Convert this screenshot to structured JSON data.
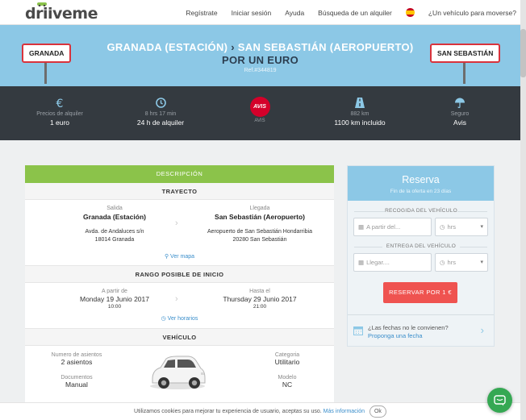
{
  "nav": {
    "logo": "driiveme",
    "links": [
      "Regístrate",
      "Iniciar sesión",
      "Ayuda",
      "Búsqueda de un alquiler"
    ],
    "flag_icon": "spain-flag-icon",
    "vehicle_question": "¿Un vehículo para moverse?"
  },
  "hero": {
    "origin_sign": "GRANADA",
    "destination_sign": "SAN SEBASTIÁN",
    "route_origin": "GRANADA (ESTACIÓN)",
    "route_arrow": "›",
    "route_destination": "SAN SEBASTIÁN (AEROPUERTO)",
    "price_line": "POR UN EURO",
    "ref": "Ref.#344819",
    "bg_color": "#8cc8e6",
    "sign_border_color": "#d9333c"
  },
  "stats": {
    "price": {
      "icon": "euro-icon",
      "label": "Precios de alquiler",
      "value": "1 euro"
    },
    "time": {
      "icon": "clock-icon",
      "label": "8 hrs 17 min",
      "value": "24 h de alquiler"
    },
    "brand": {
      "icon": "avis-logo",
      "logo_text": "AVIS",
      "label": "AVIS"
    },
    "distance": {
      "icon": "road-icon",
      "label": "882 km",
      "value": "1100 km incluido"
    },
    "insurance": {
      "icon": "umbrella-icon",
      "label": "Seguro",
      "value": "Avis"
    }
  },
  "details": {
    "tab": "DESCRIPCIÓN",
    "trayecto": {
      "header": "TRAYECTO",
      "departure_label": "Salida",
      "departure_name": "Granada (Estación)",
      "departure_addr1": "Avda. de Andaluces s/n",
      "departure_addr2": "18014 Granada",
      "arrival_label": "Llegada",
      "arrival_name": "San Sebastián (Aeropuerto)",
      "arrival_addr1": "Aeropuerto de San Sebastián Hondarribia",
      "arrival_addr2": "20280 San Sebastián",
      "map_link": "Ver mapa"
    },
    "rango": {
      "header": "RANGO POSIBLE DE INICIO",
      "from_label": "A partir de",
      "from_date": "Monday 19 Junio 2017",
      "from_time": "10:00",
      "until_label": "Hasta el",
      "until_date": "Thursday 29 Junio 2017",
      "until_time": "21:00",
      "hours_link": "Ver horarios"
    },
    "vehiculo": {
      "header": "VEHÍCULO",
      "seats_label": "Numero de asientos",
      "seats_value": "2 asientos",
      "docs_label": "Documentos",
      "docs_value": "Manual",
      "category_label": "Categoria",
      "category_value": "Utilitario",
      "model_label": "Modelo",
      "model_value": "NC"
    },
    "tab_color": "#8bc34a"
  },
  "reserva": {
    "title": "Reserva",
    "subtitle": "Fin de la oferta en 23 días",
    "pickup_label": "RECOGIDA DEL VEHÍCULO",
    "pickup_date_placeholder": "A partir del...",
    "pickup_hour_placeholder": "hrs",
    "dropoff_label": "ENTREGA DEL VEHÍCULO",
    "dropoff_date_placeholder": "Llegar....",
    "dropoff_hour_placeholder": "hrs",
    "book_button": "RESERVAR POR 1 €",
    "question": "¿Las fechas no le convienen?",
    "propose_link": "Proponga una fecha",
    "button_color": "#ef5350"
  },
  "cookie": {
    "text": "Utilizamos cookies para mejorar tu experiencia de usuario, aceptas su uso.",
    "more_link": "Más información",
    "ok_button": "Ok"
  },
  "chat": {
    "icon": "chat-bubble-icon",
    "color": "#35a853"
  }
}
